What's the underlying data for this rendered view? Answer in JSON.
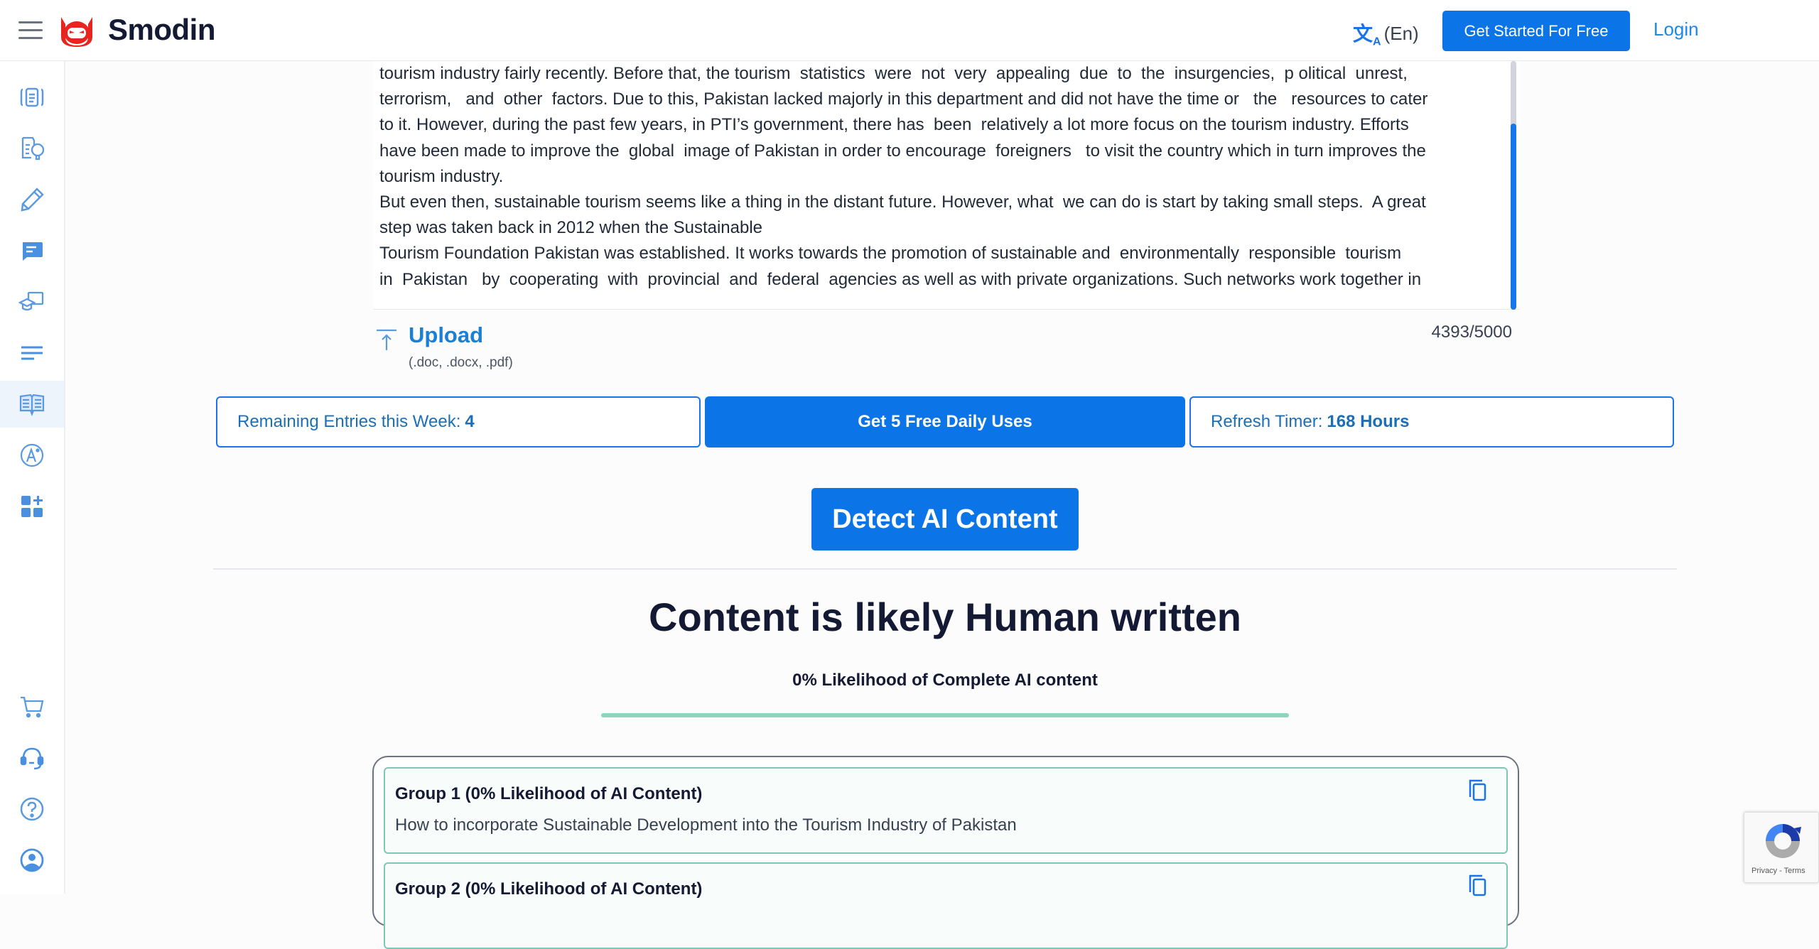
{
  "header": {
    "brand": "Smodin",
    "language": "(En)",
    "cta_label": "Get Started For Free",
    "login_label": "Login"
  },
  "sidebar": {
    "items": [
      {
        "icon": "document-scan-icon"
      },
      {
        "icon": "document-idea-icon"
      },
      {
        "icon": "pencil-icon"
      },
      {
        "icon": "chat-bubble-icon"
      },
      {
        "icon": "graduation-cap-icon"
      },
      {
        "icon": "text-lines-icon"
      },
      {
        "icon": "open-book-icon",
        "active": true
      },
      {
        "icon": "grammar-a-icon"
      },
      {
        "icon": "apps-plus-icon"
      }
    ],
    "bottom_items": [
      {
        "icon": "cart-icon"
      },
      {
        "icon": "headset-icon"
      },
      {
        "icon": "help-icon"
      },
      {
        "icon": "account-icon"
      }
    ]
  },
  "editor": {
    "lines": [
      "tourism industry fairly recently. Before that, the tourism  statistics  were  not  very  appealing  due  to  the  insurgencies,  p olitical  unrest,",
      "terrorism,   and  other  factors. Due to this, Pakistan lacked majorly in this department and did not have the time or   the   resources to cater",
      "to it. However, during the past few years, in PTI’s government, there has  been  relatively a lot more focus on the tourism industry. Efforts",
      "have been made to improve the  global  image of Pakistan in order to encourage  foreigners   to visit the country which in turn improves the",
      "tourism industry.",
      "But even then, sustainable tourism seems like a thing in the distant future. However, what  we can do is start by taking small steps.  A great",
      "step was taken back in 2012 when the Sustainable",
      "Tourism Foundation Pakistan was established. It works towards the promotion of sustainable and  environmentally  responsible  tourism",
      "in  Pakistan   by  cooperating  with  provincial  and  federal  agencies as well as with private organizations. Such networks work together in"
    ],
    "char_count": "4393/5000"
  },
  "upload": {
    "label": "Upload",
    "types": "(.doc, .docx, .pdf)"
  },
  "usage": {
    "remaining_label": "Remaining Entries this Week:",
    "remaining_value": "4",
    "daily_button": "Get 5 Free Daily Uses",
    "timer_label": "Refresh Timer:",
    "timer_value": "168 Hours"
  },
  "detect_button": "Detect AI Content",
  "result": {
    "title": "Content is likely Human written",
    "subtitle": "0% Likelihood of Complete AI content",
    "ai_likelihood_percent": 0,
    "human_bar_fraction": 1.0
  },
  "groups": [
    {
      "title": "Group 1 (0% Likelihood of AI Content)",
      "text": "How to incorporate Sustainable Development into the Tourism Industry of Pakistan"
    },
    {
      "title": "Group 2 (0% Likelihood of AI Content)",
      "text": ""
    }
  ],
  "recaptcha": {
    "links": "Privacy - Terms"
  },
  "colors": {
    "primary": "#0b75e8",
    "brand_red": "#e8241f",
    "success_bar": "#8fd4bd"
  }
}
